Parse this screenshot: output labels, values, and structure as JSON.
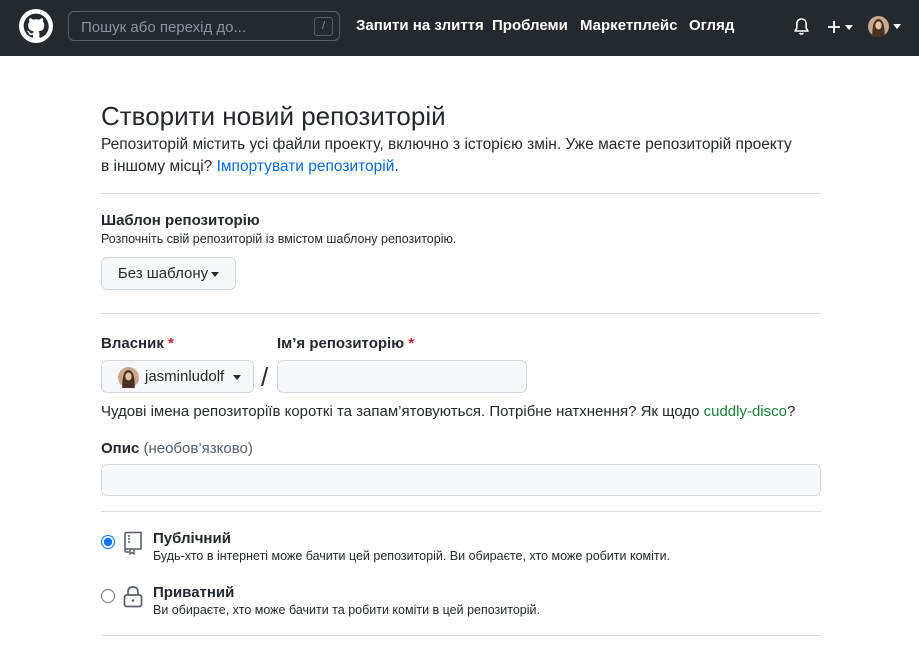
{
  "header": {
    "search_placeholder": "Пошук або перехід до...",
    "search_shortcut": "/",
    "nav": [
      {
        "label": "Запити на злиття"
      },
      {
        "label": "Проблеми"
      },
      {
        "label": "Маркетплейс"
      },
      {
        "label": "Огляд"
      }
    ],
    "colors": {
      "background": "#24292f",
      "text": "#ffffff"
    }
  },
  "page": {
    "title": "Створити новий репозиторій",
    "subtitle": "Репозиторій містить усі файли проекту, включно з історією змін. Уже маєте репозиторій проекту в іншому місці?",
    "import_link": "Імпортувати репозиторій",
    "import_link_suffix": "."
  },
  "template": {
    "label": "Шаблон репозиторію",
    "note": "Розпочніть свій репозиторій із вмістом шаблону репозиторію.",
    "select_value": "Без шаблону"
  },
  "owner": {
    "label": "Власник",
    "required_mark": "*",
    "value": "jasminludolf"
  },
  "repo_name": {
    "label": "Ім’я репозиторію",
    "required_mark": "*",
    "value": "",
    "separator": "/"
  },
  "name_hint": {
    "text": "Чудові імена репозиторіїв короткі та запам’ятовуються. Потрібне натхнення? Як щодо ",
    "suggestion": "cuddly-disco",
    "suffix": "?"
  },
  "description": {
    "label": "Опис",
    "optional": "(необов’язково)",
    "value": ""
  },
  "visibility": {
    "selected": "public",
    "options": [
      {
        "id": "public",
        "title": "Публічний",
        "desc": "Будь-хто в інтернеті може бачити цей репозиторій. Ви обираєте, хто може робити коміти.",
        "icon": "repo-icon"
      },
      {
        "id": "private",
        "title": "Приватний",
        "desc": "Ви обираєте, хто може бачити та робити коміти в цей репозиторій.",
        "icon": "lock-icon"
      }
    ]
  },
  "colors": {
    "link": "#0969da",
    "required": "#cf222e",
    "suggestion": "#1a7f37",
    "divider": "#d8dee4"
  }
}
